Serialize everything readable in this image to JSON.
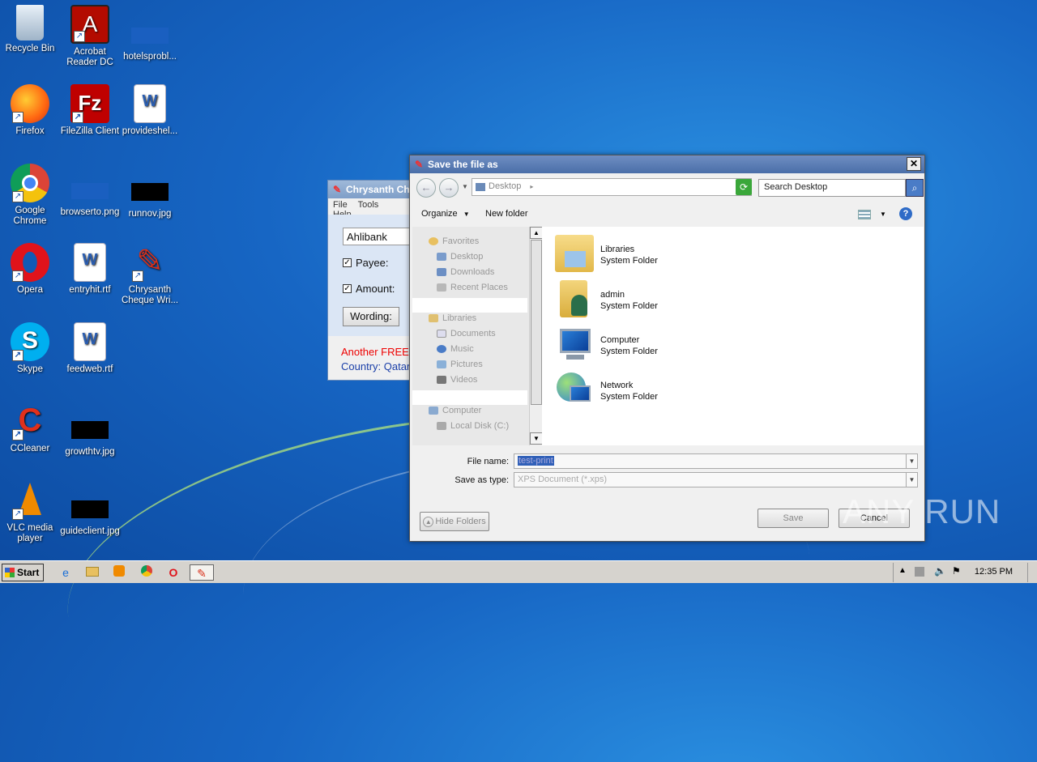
{
  "desktop": {
    "icons": [
      {
        "label": "Recycle Bin",
        "icon": "recycle-bin-icon"
      },
      {
        "label": "Acrobat Reader DC",
        "icon": "acrobat-icon"
      },
      {
        "label": "hotelsprobl...",
        "icon": "image-file-icon"
      },
      {
        "label": "Firefox",
        "icon": "firefox-icon"
      },
      {
        "label": "FileZilla Client",
        "icon": "filezilla-icon"
      },
      {
        "label": "provideshel...",
        "icon": "word-doc-icon"
      },
      {
        "label": "Google Chrome",
        "icon": "chrome-icon"
      },
      {
        "label": "browserto.png",
        "icon": "image-file-icon"
      },
      {
        "label": "runnov.jpg",
        "icon": "image-file-icon"
      },
      {
        "label": "Opera",
        "icon": "opera-icon"
      },
      {
        "label": "entryhit.rtf",
        "icon": "word-doc-icon"
      },
      {
        "label": "Chrysanth Cheque Wri...",
        "icon": "feather-icon"
      },
      {
        "label": "Skype",
        "icon": "skype-icon"
      },
      {
        "label": "feedweb.rtf",
        "icon": "word-doc-icon"
      },
      {
        "label": "CCleaner",
        "icon": "ccleaner-icon"
      },
      {
        "label": "growthtv.jpg",
        "icon": "image-file-icon"
      },
      {
        "label": "VLC media player",
        "icon": "vlc-icon"
      },
      {
        "label": "guideclient.jpg",
        "icon": "image-file-icon"
      }
    ]
  },
  "bgapp": {
    "title": "Chrysanth Ch",
    "menu": [
      "File",
      "Tools",
      "Help"
    ],
    "bank": "Ahlibank",
    "payee_label": "Payee:",
    "amount_label": "Amount:",
    "wording_label": "Wording:",
    "promo": "Another FREE",
    "country": "Country: Qatar"
  },
  "dialog": {
    "title": "Save the file as",
    "address": "Desktop",
    "search_placeholder": "Search Desktop",
    "organize": "Organize",
    "new_folder": "New folder",
    "nav": {
      "favorites": "Favorites",
      "desktop": "Desktop",
      "downloads": "Downloads",
      "recent": "Recent Places",
      "libraries": "Libraries",
      "documents": "Documents",
      "music": "Music",
      "pictures": "Pictures",
      "videos": "Videos",
      "computer": "Computer",
      "local_disk": "Local Disk (C:)"
    },
    "items": [
      {
        "name": "Libraries",
        "type": "System Folder",
        "icon": "libraries-folder-icon"
      },
      {
        "name": "admin",
        "type": "System Folder",
        "icon": "user-folder-icon"
      },
      {
        "name": "Computer",
        "type": "System Folder",
        "icon": "computer-icon"
      },
      {
        "name": "Network",
        "type": "System Folder",
        "icon": "network-icon"
      }
    ],
    "file_name_label": "File name:",
    "file_name_value": "test-print",
    "save_type_label": "Save as type:",
    "save_type_value": "XPS Document (*.xps)",
    "hide_folders": "Hide Folders",
    "save": "Save",
    "cancel": "Cancel"
  },
  "taskbar": {
    "start": "Start",
    "clock": "12:35 PM"
  },
  "watermark": "ANY RUN"
}
